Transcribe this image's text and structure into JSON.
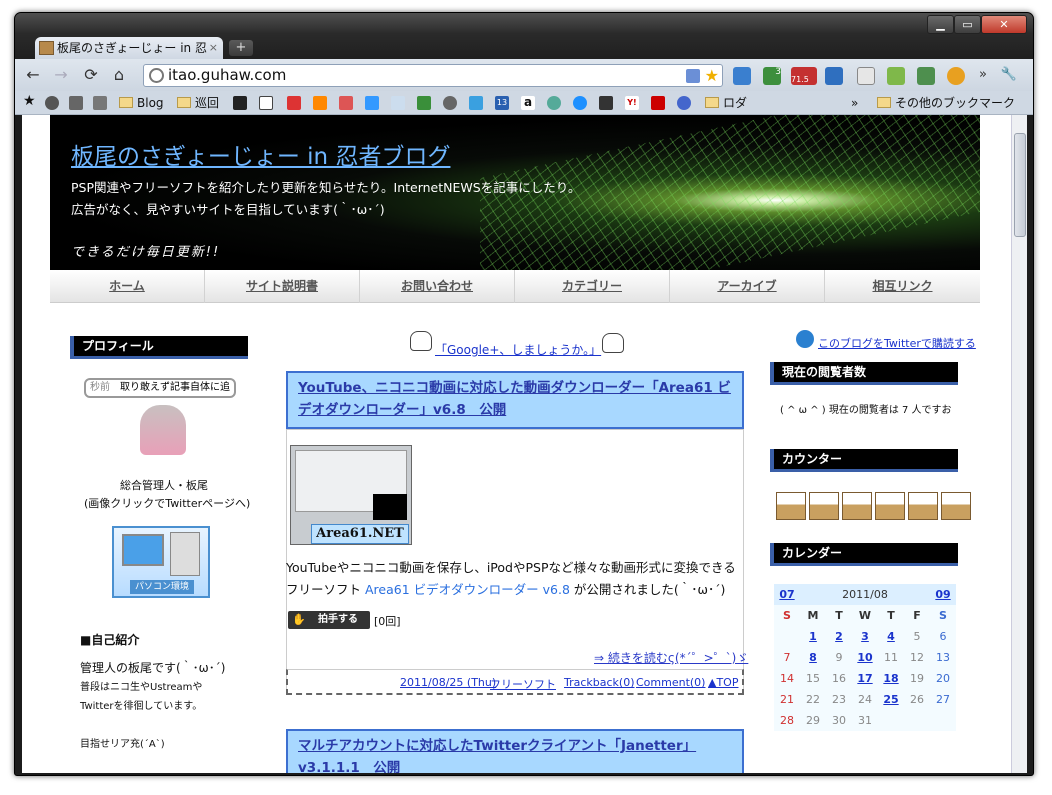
{
  "window": {
    "minimize": "▁",
    "maximize": "▭",
    "close": "✕"
  },
  "tab": {
    "title": "板尾のさぎょーじょー in 忍",
    "close": "×"
  },
  "newtab": "+",
  "toolbar": {
    "back": "←",
    "forward": "→",
    "reload": "⟳",
    "home": "⌂",
    "url": "itao.guhaw.com",
    "badge_rss": "3",
    "badge_count": "71.5",
    "more": "»",
    "wrench": "🔧"
  },
  "bookmarks": {
    "blog": "Blog",
    "junkai": "巡回",
    "roda": "ロダ",
    "more": "»",
    "other": "その他のブックマーク",
    "amazon": "a",
    "yahoo": "Y!",
    "num13": "13"
  },
  "blog": {
    "title": "板尾のさぎょーじょー in 忍者ブログ",
    "desc1": "PSP関連やフリーソフトを紹介したり更新を知らせたり。InternetNEWSを記事にしたり。",
    "desc2": "広告がなく、見やすいサイトを目指しています(｀･ω･´)",
    "tagline": "できるだけ毎日更新!!",
    "menu": [
      "ホーム",
      "サイト説明書",
      "お問い合わせ",
      "カテゴリー",
      "アーカイブ",
      "相互リンク"
    ]
  },
  "left": {
    "profile_head": "プロフィール",
    "tweet_time": "秒前",
    "tweet": "取り敢えず記事自体に追",
    "admin": "総合管理人・板尾",
    "admin_note": "(画像クリックでTwitterページへ)",
    "pc_label": "パソコン環境",
    "intro_head": "■自己紹介",
    "intro1": "管理人の板尾です(｀･ω･´)",
    "intro2": "普段はニコ生やUstreamや",
    "intro3": "Twitterを徘徊しています。",
    "intro4": "目指せリア充(´A`)"
  },
  "center": {
    "gplus": "「Google+、しましょうか。」",
    "post1_title": "YouTube、ニコニコ動画に対応した動画ダウンローダー「Area61 ビデオダウンローダー」v6.8　公開",
    "thumb_label": "Area61.NET",
    "post1_text1": "YouTubeやニコニコ動画を保存し、iPodやPSPなど様々な動画形式に変換できる",
    "post1_text2a": "フリーソフト",
    "post1_link": "Area61 ビデオダウンローダー v6.8",
    "post1_text2b": "が公開されました(｀･ω･´)",
    "clap_btn": "拍手する",
    "clap_count": "[0回]",
    "readmore": "⇒ 続きを読むς(*´゜>゜`)ゞ",
    "date": "2011/08/25 (Thu)",
    "category": "フリーソフト",
    "trackback": "Trackback(0)",
    "comment": "Comment(0)",
    "top": "▲TOP",
    "post2_title": "マルチアカウントに対応したTwitterクライアント「Janetter」 v3.1.1.1　公開"
  },
  "right": {
    "twitter_link": "このブログをTwitterで購読する",
    "viewers_head": "現在の閲覧者数",
    "viewers_text": "( ^ ω ^ ) 現在の閲覧者は 7 人ですお",
    "counter_head": "カウンター",
    "calendar_head": "カレンダー",
    "cal_prev": "07",
    "cal_month": "2011/08",
    "cal_next": "09",
    "dow": [
      "S",
      "M",
      "T",
      "W",
      "T",
      "F",
      "S"
    ],
    "weeks": [
      [
        "",
        "1",
        "2",
        "3",
        "4",
        "5",
        "6"
      ],
      [
        "7",
        "8",
        "9",
        "10",
        "11",
        "12",
        "13"
      ],
      [
        "14",
        "15",
        "16",
        "17",
        "18",
        "19",
        "20"
      ],
      [
        "21",
        "22",
        "23",
        "24",
        "25",
        "26",
        "27"
      ],
      [
        "28",
        "29",
        "30",
        "31",
        "",
        "",
        ""
      ]
    ],
    "linked_days": [
      "1",
      "2",
      "3",
      "4",
      "8",
      "10",
      "17",
      "18",
      "25"
    ]
  }
}
